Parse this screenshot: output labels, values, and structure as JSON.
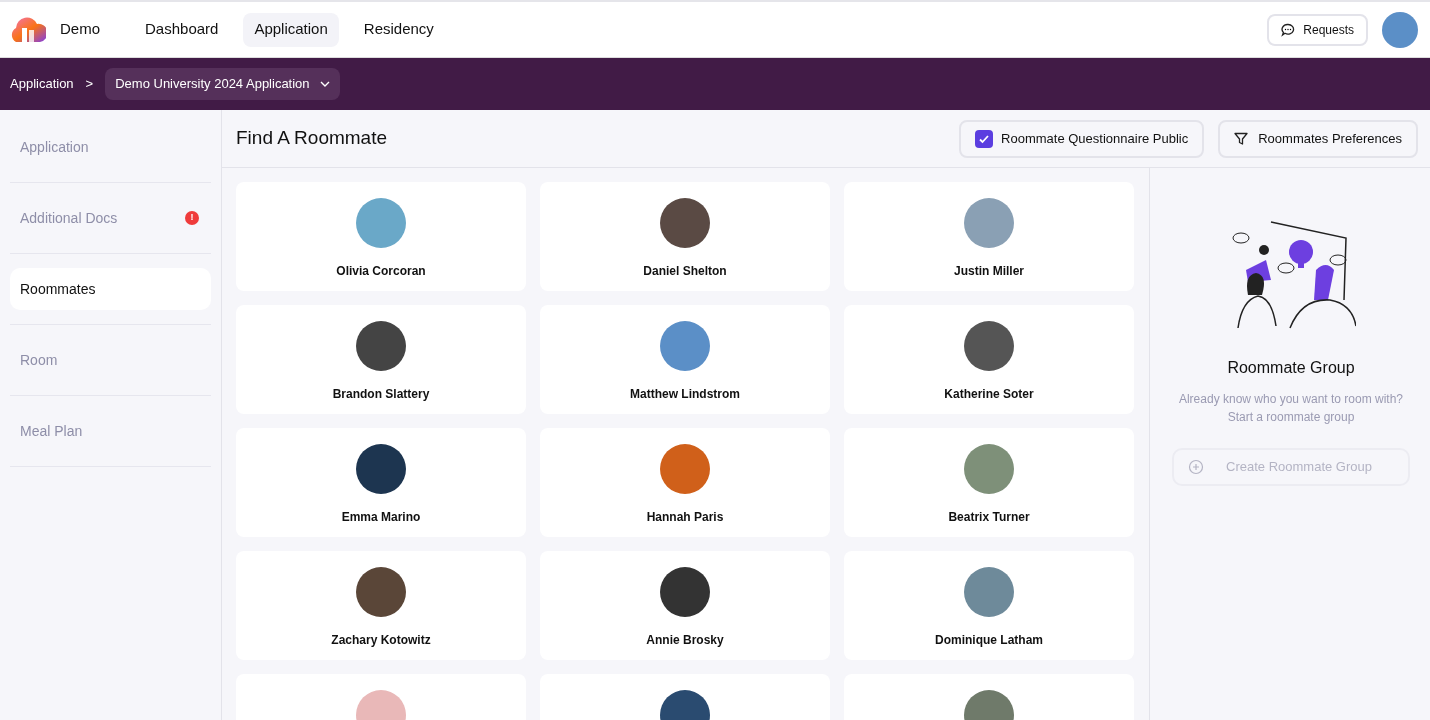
{
  "nav": {
    "brand": "Demo",
    "tabs": [
      {
        "label": "Dashboard",
        "selected": false
      },
      {
        "label": "Application",
        "selected": true
      },
      {
        "label": "Residency",
        "selected": false
      }
    ],
    "requests_button": "Requests"
  },
  "breadcrumb": {
    "root": "Application",
    "separator": ">",
    "current": "Demo University 2024 Application"
  },
  "sidebar": {
    "items": [
      {
        "label": "Application",
        "selected": false,
        "alert": false
      },
      {
        "label": "Additional Docs",
        "selected": false,
        "alert": true,
        "alert_text": "!"
      },
      {
        "label": "Roommates",
        "selected": true,
        "alert": false
      },
      {
        "label": "Room",
        "selected": false,
        "alert": false
      },
      {
        "label": "Meal Plan",
        "selected": false,
        "alert": false
      }
    ]
  },
  "header": {
    "title": "Find A Roommate",
    "public_checkbox": {
      "label": "Roommate Questionnaire Public",
      "checked": true
    },
    "preferences_button": "Roommates Preferences"
  },
  "roommates": [
    {
      "name": "Olivia Corcoran",
      "photo": true
    },
    {
      "name": "Daniel Shelton",
      "photo": true
    },
    {
      "name": "Justin Miller",
      "photo": true
    },
    {
      "name": "Brandon Slattery",
      "photo": true
    },
    {
      "name": "Matthew Lindstrom",
      "photo": true
    },
    {
      "name": "Katherine Soter",
      "photo": true
    },
    {
      "name": "Emma Marino",
      "photo": true
    },
    {
      "name": "Hannah Paris",
      "photo": true
    },
    {
      "name": "Beatrix Turner",
      "photo": true
    },
    {
      "name": "Zachary Kotowitz",
      "photo": true
    },
    {
      "name": "Annie Brosky",
      "photo": true
    },
    {
      "name": "Dominique Latham",
      "photo": true
    },
    {
      "photo": true
    },
    {
      "photo": true
    },
    {
      "photo": true
    }
  ],
  "group_panel": {
    "title": "Roommate Group",
    "description": "Already know who you want to room with? Start a roommate group",
    "create_button": {
      "label": "Create Roommate Group",
      "disabled": true
    }
  }
}
